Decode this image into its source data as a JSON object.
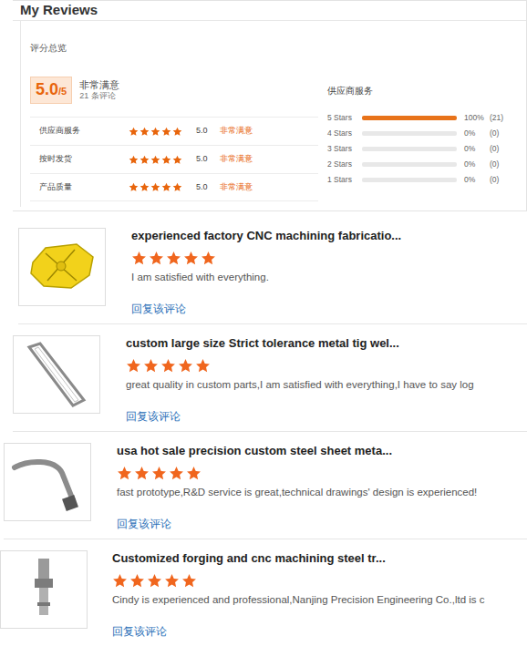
{
  "header": {
    "title": "My Reviews"
  },
  "overview": {
    "label": "评分总览",
    "score": "5.0",
    "score_max": "/5",
    "verdict": "非常满意",
    "count": "21 条评论",
    "aspects": [
      {
        "label": "供应商服务",
        "stars": 5,
        "score": "5.0",
        "verdict": "非常满意"
      },
      {
        "label": "按时发货",
        "stars": 5,
        "score": "5.0",
        "verdict": "非常满意"
      },
      {
        "label": "产品质量",
        "stars": 5,
        "score": "5.0",
        "verdict": "非常满意"
      }
    ]
  },
  "distribution": {
    "title": "供应商服务",
    "rows": [
      {
        "label": "5 Stars",
        "level": 1,
        "percent": "100%",
        "count": "(21)"
      },
      {
        "label": "4 Stars",
        "level": 0,
        "percent": "0%",
        "count": "(0)"
      },
      {
        "label": "3 Stars",
        "level": 0,
        "percent": "0%",
        "count": "(0)"
      },
      {
        "label": "2 Stars",
        "level": 0,
        "percent": "0%",
        "count": "(0)"
      },
      {
        "label": "1 Stars",
        "level": 0,
        "percent": "0%",
        "count": "(0)"
      }
    ]
  },
  "reviews": [
    {
      "title": "experienced factory CNC machining fabricatio...",
      "stars": 5,
      "text": "I am satisfied with everything.",
      "reply": "回复该评论"
    },
    {
      "title": "custom large size Strict tolerance metal tig wel...",
      "stars": 5,
      "text": "great quality in custom parts,I am satisfied with everything,I have to say log",
      "reply": "回复该评论"
    },
    {
      "title": "usa hot sale precision custom steel sheet meta...",
      "stars": 5,
      "text": "fast prototype,R&D service is great,technical drawings' design is experienced!",
      "reply": "回复该评论"
    },
    {
      "title": "Customized forging and cnc machining steel tr...",
      "stars": 5,
      "text": "Cindy is experienced and professional,Nanjing Precision Engineering Co.,ltd is c",
      "reply": "回复该评论"
    }
  ]
}
